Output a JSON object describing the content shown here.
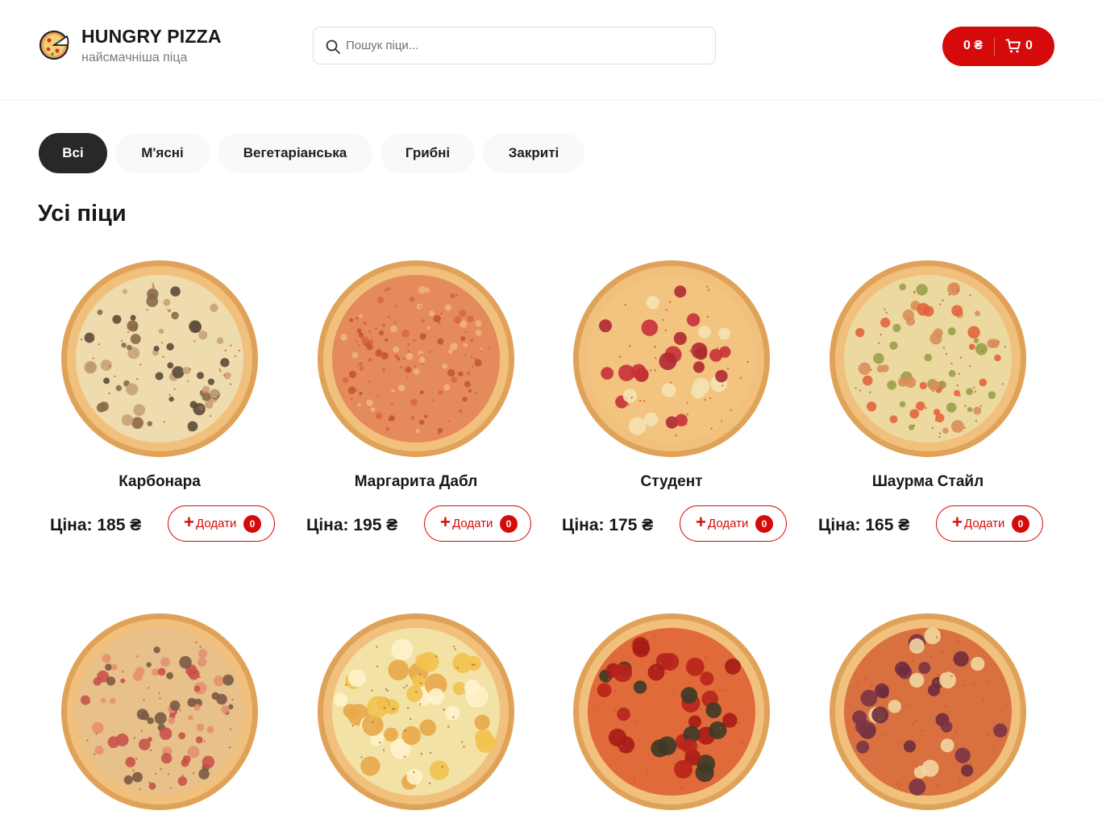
{
  "header": {
    "brand_title": "HUNGRY PIZZA",
    "brand_subtitle": "найсмачніша піца",
    "search_placeholder": "Пошук піци...",
    "cart_total": "0 ₴",
    "cart_count": "0"
  },
  "categories": [
    {
      "label": "Всі",
      "active": true
    },
    {
      "label": "М'ясні",
      "active": false
    },
    {
      "label": "Вегетаріанська",
      "active": false
    },
    {
      "label": "Грибні",
      "active": false
    },
    {
      "label": "Закриті",
      "active": false
    }
  ],
  "section_title": "Усі піци",
  "add_label": "Додати",
  "pizzas": [
    {
      "name": "Карбонара",
      "price": "Ціна: 185 ₴",
      "count": "0",
      "style": "carbonara"
    },
    {
      "name": "Маргарита Дабл",
      "price": "Ціна: 195 ₴",
      "count": "0",
      "style": "margherita"
    },
    {
      "name": "Студент",
      "price": "Ціна: 175 ₴",
      "count": "0",
      "style": "student"
    },
    {
      "name": "Шаурма Стайл",
      "price": "Ціна: 165 ₴",
      "count": "0",
      "style": "shawarma"
    },
    {
      "name": "",
      "price": "",
      "count": "",
      "style": "mushroom-meat"
    },
    {
      "name": "",
      "price": "",
      "count": "",
      "style": "four-cheese"
    },
    {
      "name": "",
      "price": "",
      "count": "",
      "style": "pepperoni"
    },
    {
      "name": "",
      "price": "",
      "count": "",
      "style": "salami"
    }
  ],
  "colors": {
    "accent": "#d50b0b",
    "active_category": "#282828",
    "category_bg": "#f9f9f9",
    "crust": "#e0a258"
  },
  "icons": {
    "logo": "pizza-slice-icon",
    "search": "search-icon",
    "cart": "cart-icon",
    "add": "plus-icon"
  }
}
